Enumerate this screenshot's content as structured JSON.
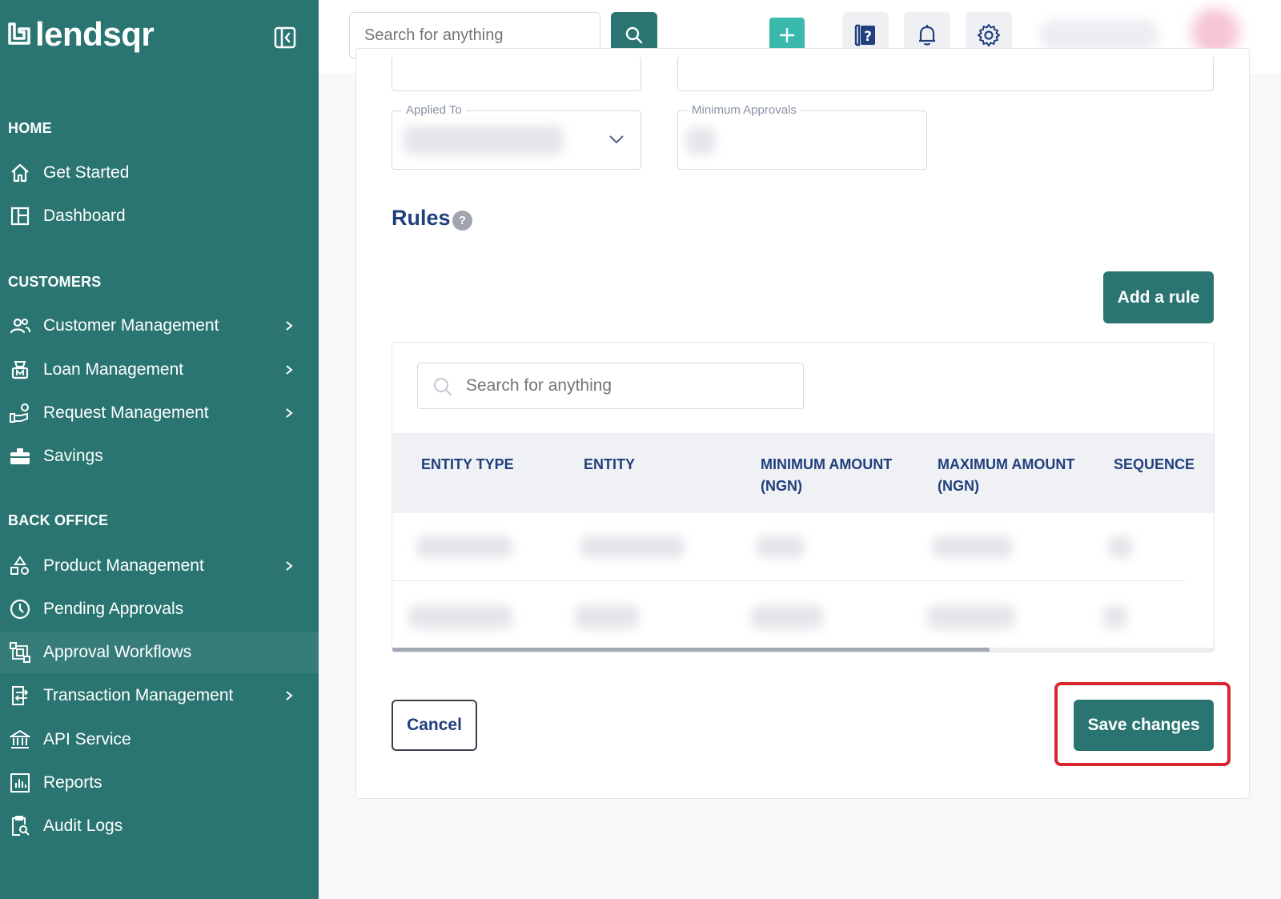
{
  "app": {
    "brand": "lendsqr"
  },
  "sidebar": {
    "sections": [
      {
        "title": "HOME"
      },
      {
        "title": "CUSTOMERS"
      },
      {
        "title": "BACK OFFICE"
      }
    ],
    "items": [
      {
        "label": "Get Started",
        "icon": "home-icon"
      },
      {
        "label": "Dashboard",
        "icon": "dashboard-icon"
      },
      {
        "label": "Customer Management",
        "icon": "users-icon",
        "chevron": true
      },
      {
        "label": "Loan Management",
        "icon": "loan-icon",
        "chevron": true
      },
      {
        "label": "Request Management",
        "icon": "request-icon",
        "chevron": true
      },
      {
        "label": "Savings",
        "icon": "briefcase-icon"
      },
      {
        "label": "Product Management",
        "icon": "product-icon",
        "chevron": true
      },
      {
        "label": "Pending Approvals",
        "icon": "clock-icon"
      },
      {
        "label": "Approval Workflows",
        "icon": "workflow-icon",
        "active": true
      },
      {
        "label": "Transaction Management",
        "icon": "transaction-icon",
        "chevron": true
      },
      {
        "label": "API Service",
        "icon": "bank-icon"
      },
      {
        "label": "Reports",
        "icon": "chart-icon"
      },
      {
        "label": "Audit Logs",
        "icon": "audit-icon"
      }
    ]
  },
  "topbar": {
    "search_placeholder": "Search for anything"
  },
  "form": {
    "applied_to_label": "Applied To",
    "minimum_approvals_label": "Minimum Approvals"
  },
  "rules": {
    "title": "Rules",
    "help": "?",
    "add_button": "Add a rule",
    "search_placeholder": "Search for anything",
    "columns": [
      "ENTITY TYPE",
      "ENTITY",
      "MINIMUM AMOUNT (NGN)",
      "MAXIMUM AMOUNT (NGN)",
      "SEQUENCE"
    ]
  },
  "actions": {
    "cancel": "Cancel",
    "save": "Save changes"
  },
  "colors": {
    "sidebar": "#2a7571",
    "accent": "#39b8ac",
    "highlight": "#d9252c"
  }
}
